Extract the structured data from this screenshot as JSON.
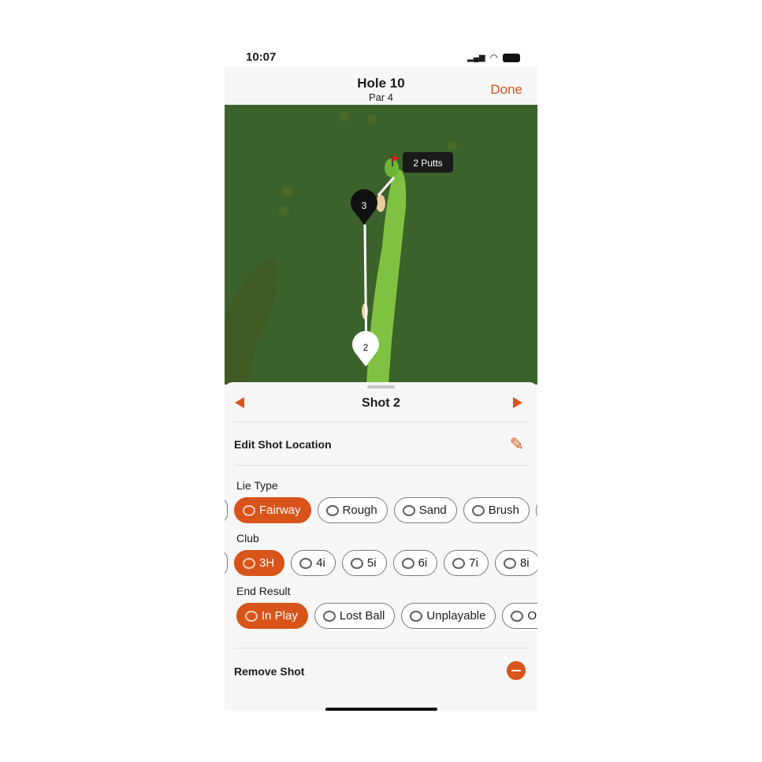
{
  "status": {
    "time": "10:07"
  },
  "nav": {
    "title": "Hole 10",
    "subtitle": "Par 4",
    "done": "Done"
  },
  "map": {
    "putts_label": "2 Putts",
    "pins": [
      "3",
      "2"
    ]
  },
  "sheet": {
    "shot_title": "Shot 2",
    "edit_location": "Edit Shot Location",
    "remove_shot": "Remove Shot",
    "lie_label": "Lie Type",
    "lie_options": [
      "Fairway",
      "Rough",
      "Sand",
      "Brush"
    ],
    "lie_selected": "Fairway",
    "club_label": "Club",
    "club_options": [
      "3H",
      "4i",
      "5i",
      "6i",
      "7i",
      "8i"
    ],
    "club_selected": "3H",
    "result_label": "End Result",
    "result_options": [
      "In Play",
      "Lost Ball",
      "Unplayable",
      "Out"
    ],
    "result_selected": "In Play"
  },
  "colors": {
    "accent": "#d9541a",
    "rough": "#3d6b2a",
    "fairway": "#7fc241"
  }
}
